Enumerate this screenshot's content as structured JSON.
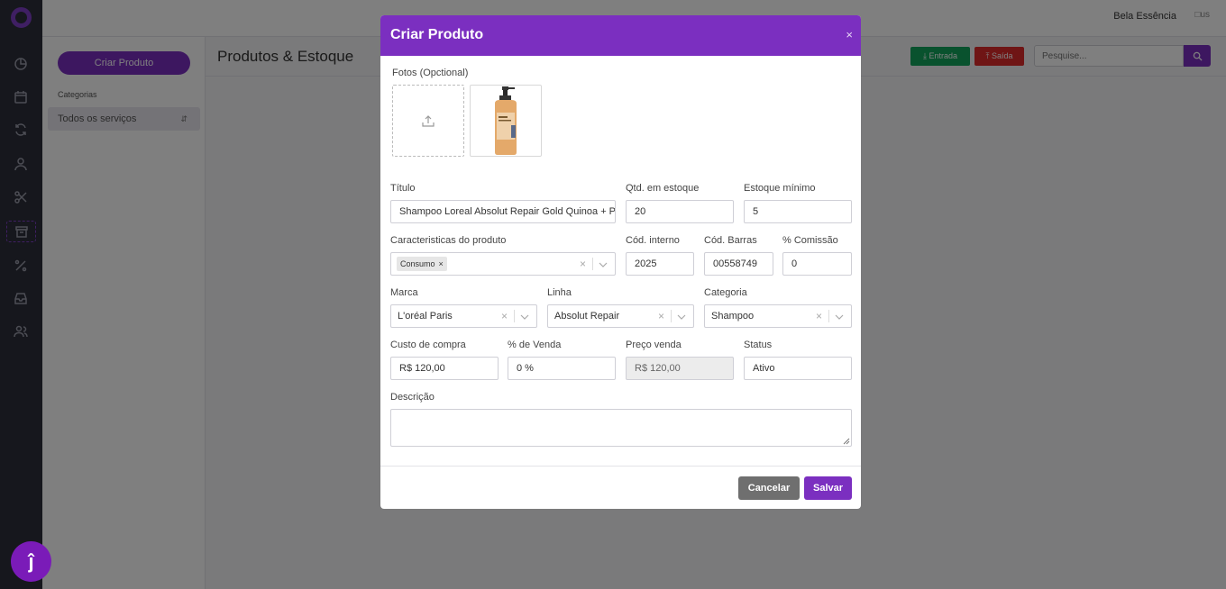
{
  "app": {
    "company_name": "Bela Essência",
    "avatar_alt": "us",
    "accent_color": "#7b2fc0"
  },
  "rail": {
    "icons": [
      "logo-icon",
      "dashboard-icon",
      "calendar-icon",
      "refresh-icon",
      "user-icon",
      "scissors-icon",
      "box-icon",
      "percent-icon",
      "inbox-icon",
      "users-icon"
    ],
    "help_glyph": "ĵ"
  },
  "sidebar": {
    "create_button": "Criar Produto",
    "categories_label": "Categorias",
    "selected_category": "Todos os serviços"
  },
  "main": {
    "page_title": "Produtos & Estoque",
    "entrada_label": "Entrada",
    "saida_label": "Saída",
    "search_placeholder": "Pesquise..."
  },
  "modal": {
    "title": "Criar Produto",
    "close_glyph": "×",
    "photos_label": "Fotos (Opctional)",
    "fields": {
      "titulo_label": "Título",
      "titulo_value": "Shampoo Loreal Absolut Repair Gold Quinoa + P",
      "qtd_label": "Qtd. em estoque",
      "qtd_value": "20",
      "estoque_min_label": "Estoque mínimo",
      "estoque_min_value": "5",
      "caracteristicas_label": "Caracteristicas do produto",
      "caracteristicas_chip": "Consumo",
      "cod_interno_label": "Cód. interno",
      "cod_interno_value": "2025",
      "cod_barras_label": "Cód. Barras",
      "cod_barras_value": "00558749",
      "comissao_label": "% Comissão",
      "comissao_value": "0",
      "marca_label": "Marca",
      "marca_value": "L'oréal Paris",
      "linha_label": "Linha",
      "linha_value": "Absolut Repair",
      "categoria_label": "Categoria",
      "categoria_value": "Shampoo",
      "custo_label": "Custo de compra",
      "custo_value": "R$ 120,00",
      "venda_pct_label": "% de Venda",
      "venda_pct_value": "0  %",
      "preco_label": "Preço venda",
      "preco_value": "R$ 120,00",
      "status_label": "Status",
      "status_value": "Ativo",
      "descricao_label": "Descrição"
    },
    "cancel_button": "Cancelar",
    "save_button": "Salvar"
  }
}
